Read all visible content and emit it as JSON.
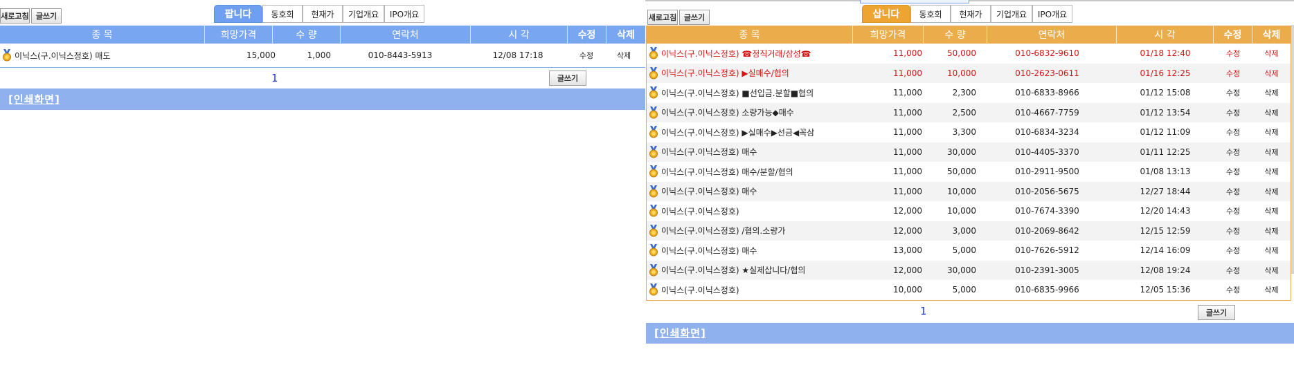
{
  "left": {
    "refresh_label": "새로고침",
    "write_label": "글쓰기",
    "tabs": [
      {
        "label": "팝니다"
      },
      {
        "label": "동호회"
      },
      {
        "label": "현재가"
      },
      {
        "label": "기업개요"
      },
      {
        "label": "IPO개요"
      }
    ],
    "headers": [
      "종  목",
      "희망가격",
      "수 량",
      "연락처",
      "시 각",
      "수정",
      "삭제"
    ],
    "rows": [
      {
        "name": "이닉스(구.이닉스정호) 매도",
        "price": "15,000",
        "qty": "1,000",
        "contact": "010-8443-5913",
        "time": "12/08 17:18",
        "edit": "수정",
        "del": "삭제"
      }
    ],
    "page": "1",
    "write_bottom_label": "글쓰기",
    "print_label": "[인쇄화면]"
  },
  "right": {
    "refresh_label": "새로고침",
    "write_label": "글쓰기",
    "tabs": [
      {
        "label": "삽니다"
      },
      {
        "label": "동호회"
      },
      {
        "label": "현재가"
      },
      {
        "label": "기업개요"
      },
      {
        "label": "IPO개요"
      }
    ],
    "headers": [
      "종  목",
      "희망가격",
      "수 량",
      "연락처",
      "시 각",
      "수정",
      "삭제"
    ],
    "rows": [
      {
        "name": "이닉스(구.이닉스정호) ☎정직거래/삼성☎",
        "price": "11,000",
        "qty": "50,000",
        "contact": "010-6832-9610",
        "time": "01/18 12:40",
        "edit": "수정",
        "del": "삭제"
      },
      {
        "name": "이닉스(구.이닉스정호) ▶실매수/협의",
        "price": "11,000",
        "qty": "10,000",
        "contact": "010-2623-0611",
        "time": "01/16 12:25",
        "edit": "수정",
        "del": "삭제"
      },
      {
        "name": "이닉스(구.이닉스정호) ■선입금.분할■협의",
        "price": "11,000",
        "qty": "2,300",
        "contact": "010-6833-8966",
        "time": "01/12 15:08",
        "edit": "수정",
        "del": "삭제"
      },
      {
        "name": "이닉스(구.이닉스정호) 소량가능◆매수",
        "price": "11,000",
        "qty": "2,500",
        "contact": "010-4667-7759",
        "time": "01/12 13:54",
        "edit": "수정",
        "del": "삭제"
      },
      {
        "name": "이닉스(구.이닉스정호) ▶실매수▶선금◀꼭삼",
        "price": "11,000",
        "qty": "3,300",
        "contact": "010-6834-3234",
        "time": "01/12 11:09",
        "edit": "수정",
        "del": "삭제"
      },
      {
        "name": "이닉스(구.이닉스정호) 매수",
        "price": "11,000",
        "qty": "30,000",
        "contact": "010-4405-3370",
        "time": "01/11 12:25",
        "edit": "수정",
        "del": "삭제"
      },
      {
        "name": "이닉스(구.이닉스정호) 매수/분할/협의",
        "price": "11,000",
        "qty": "50,000",
        "contact": "010-2911-9500",
        "time": "01/08 13:13",
        "edit": "수정",
        "del": "삭제"
      },
      {
        "name": "이닉스(구.이닉스정호) 매수",
        "price": "11,000",
        "qty": "10,000",
        "contact": "010-2056-5675",
        "time": "12/27 18:44",
        "edit": "수정",
        "del": "삭제"
      },
      {
        "name": "이닉스(구.이닉스정호)",
        "price": "12,000",
        "qty": "10,000",
        "contact": "010-7674-3390",
        "time": "12/20 14:43",
        "edit": "수정",
        "del": "삭제"
      },
      {
        "name": "이닉스(구.이닉스정호) /협의.소량가",
        "price": "12,000",
        "qty": "3,000",
        "contact": "010-2069-8642",
        "time": "12/15 12:59",
        "edit": "수정",
        "del": "삭제"
      },
      {
        "name": "이닉스(구.이닉스정호) 매수",
        "price": "13,000",
        "qty": "5,000",
        "contact": "010-7626-5912",
        "time": "12/14 16:09",
        "edit": "수정",
        "del": "삭제"
      },
      {
        "name": "이닉스(구.이닉스정호) ★실제삽니다/협의",
        "price": "12,000",
        "qty": "30,000",
        "contact": "010-2391-3005",
        "time": "12/08 19:24",
        "edit": "수정",
        "del": "삭제"
      },
      {
        "name": "이닉스(구.이닉스정호)",
        "price": "10,000",
        "qty": "5,000",
        "contact": "010-6835-9966",
        "time": "12/05 15:36",
        "edit": "수정",
        "del": "삭제"
      }
    ],
    "highlight_rows": 2,
    "page": "1",
    "write_bottom_label": "글쓰기",
    "print_label": "[인쇄화면]"
  },
  "colors": {
    "sell_accent": "#6f9ff0",
    "buy_accent": "#eea432",
    "highlight_text": "#d81212",
    "page_link": "#1a34c8"
  },
  "icons": {
    "row_icon": "medal-icon"
  }
}
